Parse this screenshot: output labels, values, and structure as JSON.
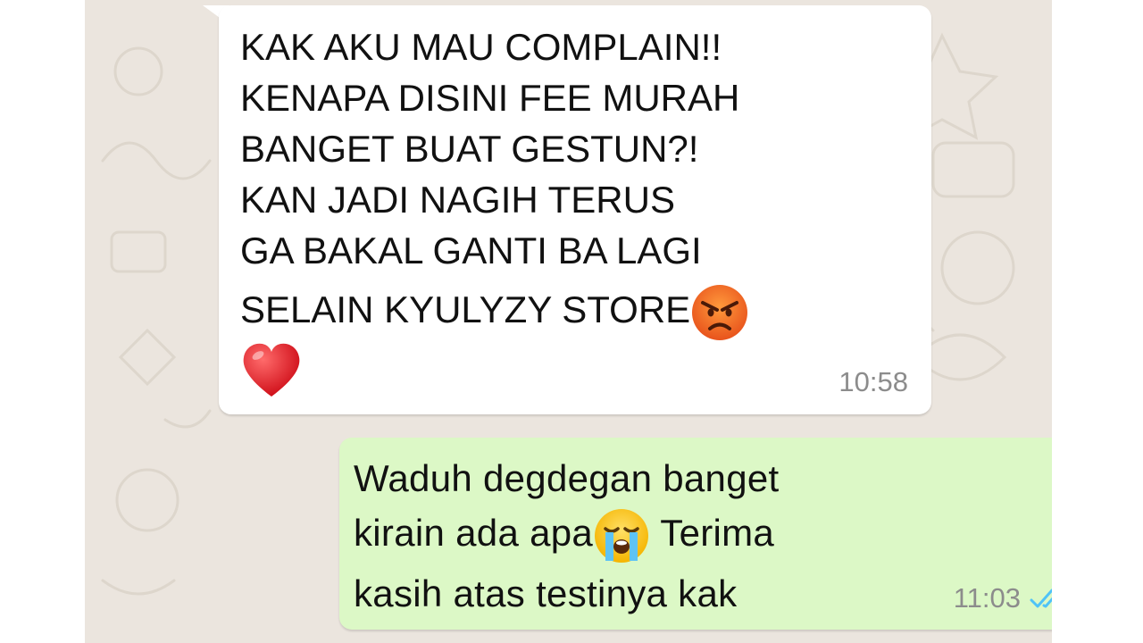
{
  "conversation": {
    "incoming": {
      "lines": [
        "KAK AKU MAU COMPLAIN!!",
        "KENAPA DISINI FEE MURAH",
        "BANGET BUAT GESTUN?!",
        "KAN JADI NAGIH TERUS",
        "GA BAKAL GANTI BA LAGI",
        "SELAIN KYULYZY STORE"
      ],
      "emoji_after_last_line": "angry-face-icon",
      "emoji_final_line": "red-heart-icon",
      "time": "10:58"
    },
    "outgoing": {
      "line1": "Waduh degdegan banget",
      "line2_before_emoji": "kirain ada apa",
      "line2_emoji": "loudly-crying-face-icon",
      "line2_after_emoji": " Terima",
      "line3": "kasih atas testinya kak",
      "time": "11:03",
      "status_icon": "double-check-read-icon"
    }
  },
  "colors": {
    "wallpaper": "#ebe5de",
    "incoming_bubble": "#ffffff",
    "outgoing_bubble": "#dcf8c6",
    "read_ticks": "#4fc3f7"
  }
}
